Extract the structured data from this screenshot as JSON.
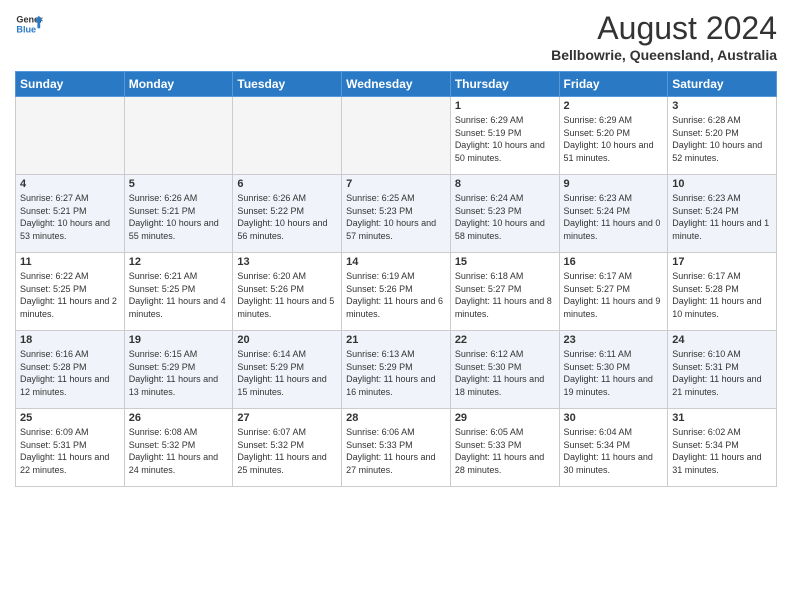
{
  "header": {
    "logo_line1": "General",
    "logo_line2": "Blue",
    "month_year": "August 2024",
    "location": "Bellbowrie, Queensland, Australia"
  },
  "days_of_week": [
    "Sunday",
    "Monday",
    "Tuesday",
    "Wednesday",
    "Thursday",
    "Friday",
    "Saturday"
  ],
  "weeks": [
    [
      {
        "day": "",
        "empty": true
      },
      {
        "day": "",
        "empty": true
      },
      {
        "day": "",
        "empty": true
      },
      {
        "day": "",
        "empty": true
      },
      {
        "day": "1",
        "sunrise": "6:29 AM",
        "sunset": "5:19 PM",
        "daylight": "10 hours and 50 minutes."
      },
      {
        "day": "2",
        "sunrise": "6:29 AM",
        "sunset": "5:20 PM",
        "daylight": "10 hours and 51 minutes."
      },
      {
        "day": "3",
        "sunrise": "6:28 AM",
        "sunset": "5:20 PM",
        "daylight": "10 hours and 52 minutes."
      }
    ],
    [
      {
        "day": "4",
        "sunrise": "6:27 AM",
        "sunset": "5:21 PM",
        "daylight": "10 hours and 53 minutes."
      },
      {
        "day": "5",
        "sunrise": "6:26 AM",
        "sunset": "5:21 PM",
        "daylight": "10 hours and 55 minutes."
      },
      {
        "day": "6",
        "sunrise": "6:26 AM",
        "sunset": "5:22 PM",
        "daylight": "10 hours and 56 minutes."
      },
      {
        "day": "7",
        "sunrise": "6:25 AM",
        "sunset": "5:23 PM",
        "daylight": "10 hours and 57 minutes."
      },
      {
        "day": "8",
        "sunrise": "6:24 AM",
        "sunset": "5:23 PM",
        "daylight": "10 hours and 58 minutes."
      },
      {
        "day": "9",
        "sunrise": "6:23 AM",
        "sunset": "5:24 PM",
        "daylight": "11 hours and 0 minutes."
      },
      {
        "day": "10",
        "sunrise": "6:23 AM",
        "sunset": "5:24 PM",
        "daylight": "11 hours and 1 minute."
      }
    ],
    [
      {
        "day": "11",
        "sunrise": "6:22 AM",
        "sunset": "5:25 PM",
        "daylight": "11 hours and 2 minutes."
      },
      {
        "day": "12",
        "sunrise": "6:21 AM",
        "sunset": "5:25 PM",
        "daylight": "11 hours and 4 minutes."
      },
      {
        "day": "13",
        "sunrise": "6:20 AM",
        "sunset": "5:26 PM",
        "daylight": "11 hours and 5 minutes."
      },
      {
        "day": "14",
        "sunrise": "6:19 AM",
        "sunset": "5:26 PM",
        "daylight": "11 hours and 6 minutes."
      },
      {
        "day": "15",
        "sunrise": "6:18 AM",
        "sunset": "5:27 PM",
        "daylight": "11 hours and 8 minutes."
      },
      {
        "day": "16",
        "sunrise": "6:17 AM",
        "sunset": "5:27 PM",
        "daylight": "11 hours and 9 minutes."
      },
      {
        "day": "17",
        "sunrise": "6:17 AM",
        "sunset": "5:28 PM",
        "daylight": "11 hours and 10 minutes."
      }
    ],
    [
      {
        "day": "18",
        "sunrise": "6:16 AM",
        "sunset": "5:28 PM",
        "daylight": "11 hours and 12 minutes."
      },
      {
        "day": "19",
        "sunrise": "6:15 AM",
        "sunset": "5:29 PM",
        "daylight": "11 hours and 13 minutes."
      },
      {
        "day": "20",
        "sunrise": "6:14 AM",
        "sunset": "5:29 PM",
        "daylight": "11 hours and 15 minutes."
      },
      {
        "day": "21",
        "sunrise": "6:13 AM",
        "sunset": "5:29 PM",
        "daylight": "11 hours and 16 minutes."
      },
      {
        "day": "22",
        "sunrise": "6:12 AM",
        "sunset": "5:30 PM",
        "daylight": "11 hours and 18 minutes."
      },
      {
        "day": "23",
        "sunrise": "6:11 AM",
        "sunset": "5:30 PM",
        "daylight": "11 hours and 19 minutes."
      },
      {
        "day": "24",
        "sunrise": "6:10 AM",
        "sunset": "5:31 PM",
        "daylight": "11 hours and 21 minutes."
      }
    ],
    [
      {
        "day": "25",
        "sunrise": "6:09 AM",
        "sunset": "5:31 PM",
        "daylight": "11 hours and 22 minutes."
      },
      {
        "day": "26",
        "sunrise": "6:08 AM",
        "sunset": "5:32 PM",
        "daylight": "11 hours and 24 minutes."
      },
      {
        "day": "27",
        "sunrise": "6:07 AM",
        "sunset": "5:32 PM",
        "daylight": "11 hours and 25 minutes."
      },
      {
        "day": "28",
        "sunrise": "6:06 AM",
        "sunset": "5:33 PM",
        "daylight": "11 hours and 27 minutes."
      },
      {
        "day": "29",
        "sunrise": "6:05 AM",
        "sunset": "5:33 PM",
        "daylight": "11 hours and 28 minutes."
      },
      {
        "day": "30",
        "sunrise": "6:04 AM",
        "sunset": "5:34 PM",
        "daylight": "11 hours and 30 minutes."
      },
      {
        "day": "31",
        "sunrise": "6:02 AM",
        "sunset": "5:34 PM",
        "daylight": "11 hours and 31 minutes."
      }
    ]
  ],
  "labels": {
    "sunrise_prefix": "Sunrise: ",
    "sunset_prefix": "Sunset: ",
    "daylight_prefix": "Daylight: "
  }
}
